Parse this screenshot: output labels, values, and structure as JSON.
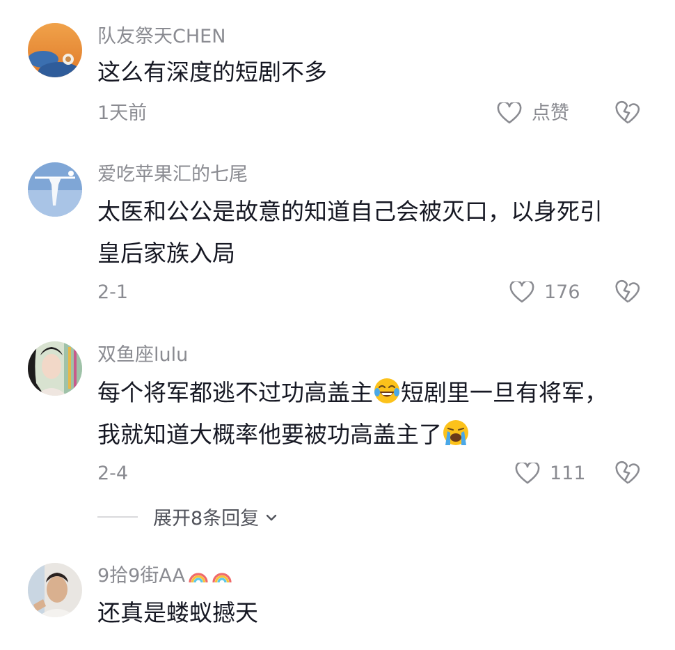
{
  "comments": [
    {
      "username": "队友祭天CHEN",
      "lines": [
        "这么有深度的短剧不多"
      ],
      "date": "1天前",
      "like_label": "点赞"
    },
    {
      "username": "爱吃苹果汇的七尾",
      "lines": [
        "太医和公公是故意的知道自己会被灭口，以身死引",
        "皇后家族入局"
      ],
      "date": "2-1",
      "like_label": "176"
    },
    {
      "username": "双鱼座lulu",
      "lines": [
        "每个将军都逃不过功高盖主",
        "短剧里一旦有将军，",
        "我就知道大概率他要被功高盖主了"
      ],
      "date": "2-4",
      "like_label": "111"
    },
    {
      "username": "9拾9街AA",
      "lines": [
        "还真是蝼蚁撼天"
      ]
    }
  ],
  "replies": {
    "expand_label": "展开8条回复"
  },
  "icons": {
    "like": "heart-outline-icon",
    "dislike": "broken-heart-outline-icon",
    "expand": "chevron-down-icon",
    "emoji_laugh": "tears-of-joy-emoji",
    "emoji_cry": "loudly-crying-emoji",
    "badge": "rainbow-icon"
  },
  "colors": {
    "text": "#161823",
    "meta": "#8a8b91",
    "expand": "#50525a",
    "divider": "#d9d9dc"
  }
}
